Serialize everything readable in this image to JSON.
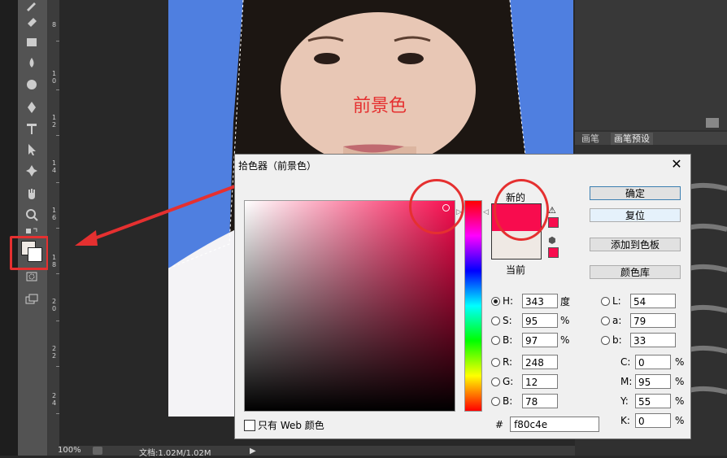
{
  "canvas": {
    "annotation_text": "前景色"
  },
  "ruler": {
    "numbers": [
      "8",
      "1\n0",
      "1\n2",
      "1\n4",
      "1\n6",
      "1\n8",
      "2\n0",
      "2\n2",
      "2\n4"
    ]
  },
  "status": {
    "zoom": "100%",
    "doc": "文档:1.02M/1.02M"
  },
  "panel": {
    "tabs": [
      "画笔",
      "画笔预设"
    ]
  },
  "dialog": {
    "title": "拾色器（前景色）",
    "new_label": "新的",
    "current_label": "当前",
    "buttons": {
      "ok": "确定",
      "reset": "复位",
      "add_swatch": "添加到色板",
      "library": "颜色库"
    },
    "hsb": [
      {
        "label": "H:",
        "value": "343",
        "unit": "度",
        "selected": true
      },
      {
        "label": "S:",
        "value": "95",
        "unit": "%",
        "selected": false
      },
      {
        "label": "B:",
        "value": "97",
        "unit": "%",
        "selected": false
      }
    ],
    "rgb": [
      {
        "label": "R:",
        "value": "248"
      },
      {
        "label": "G:",
        "value": "12"
      },
      {
        "label": "B:",
        "value": "78"
      }
    ],
    "lab": [
      {
        "label": "L:",
        "value": "54"
      },
      {
        "label": "a:",
        "value": "79"
      },
      {
        "label": "b:",
        "value": "33"
      }
    ],
    "cmyk": [
      {
        "label": "C:",
        "value": "0",
        "unit": "%"
      },
      {
        "label": "M:",
        "value": "95",
        "unit": "%"
      },
      {
        "label": "Y:",
        "value": "55",
        "unit": "%"
      },
      {
        "label": "K:",
        "value": "0",
        "unit": "%"
      }
    ],
    "hex_label": "#",
    "hex": "f80c4e",
    "web_only_label": "只有 Web 颜色"
  },
  "colors": {
    "new": "#f80c4e",
    "current": "#efe9e4",
    "annotation": "#e53030",
    "photo_bg": "#4f7fe0"
  }
}
